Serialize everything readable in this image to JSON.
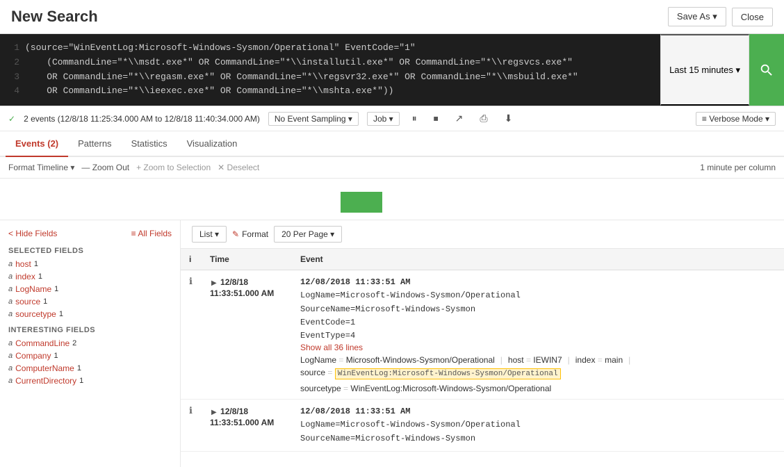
{
  "header": {
    "title": "New Search",
    "save_as_label": "Save As ▾",
    "close_label": "Close"
  },
  "query": {
    "lines": [
      {
        "num": "1",
        "text": "(source=\"WinEventLog:Microsoft-Windows-Sysmon/Operational\" EventCode=\"1\""
      },
      {
        "num": "2",
        "text": "    (CommandLine=\"*\\\\msdt.exe*\" OR CommandLine=\"*\\\\installutil.exe*\" OR CommandLine=\"*\\\\regsvcs.exe*\""
      },
      {
        "num": "3",
        "text": "    OR CommandLine=\"*\\\\regasm.exe*\" OR CommandLine=\"*\\\\regsvr32.exe*\" OR CommandLine=\"*\\\\msbuild.exe*\""
      },
      {
        "num": "4",
        "text": "    OR CommandLine=\"*\\\\ieexec.exe*\" OR CommandLine=\"*\\\\mshta.exe*\"))"
      }
    ]
  },
  "time_picker": {
    "label": "Last 15 minutes ▾"
  },
  "status_bar": {
    "check": "✓",
    "events_text": "2 events (12/8/18 11:25:34.000 AM to 12/8/18 11:40:34.000 AM)",
    "sampling_label": "No Event Sampling ▾",
    "job_label": "Job ▾",
    "pause_icon": "⏸",
    "stop_icon": "⏹",
    "send_icon": "↗",
    "print_icon": "⎙",
    "download_icon": "⬇",
    "verbose_label": "≡ Verbose Mode ▾"
  },
  "tabs": [
    {
      "label": "Events (2)",
      "active": true
    },
    {
      "label": "Patterns",
      "active": false
    },
    {
      "label": "Statistics",
      "active": false
    },
    {
      "label": "Visualization",
      "active": false
    }
  ],
  "timeline": {
    "format_timeline_label": "Format Timeline ▾",
    "zoom_out_label": "— Zoom Out",
    "zoom_selection_label": "+ Zoom to Selection",
    "deselect_label": "✕ Deselect",
    "per_column_label": "1 minute per column"
  },
  "sidebar": {
    "hide_fields_label": "< Hide Fields",
    "all_fields_label": "≡ All Fields",
    "selected_fields_title": "SELECTED FIELDS",
    "selected_fields": [
      {
        "type": "a",
        "name": "host",
        "count": "1"
      },
      {
        "type": "a",
        "name": "index",
        "count": "1"
      },
      {
        "type": "a",
        "name": "LogName",
        "count": "1"
      },
      {
        "type": "a",
        "name": "source",
        "count": "1"
      },
      {
        "type": "a",
        "name": "sourcetype",
        "count": "1"
      }
    ],
    "interesting_fields_title": "INTERESTING FIELDS",
    "interesting_fields": [
      {
        "type": "a",
        "name": "CommandLine",
        "count": "2"
      },
      {
        "type": "a",
        "name": "Company",
        "count": "1"
      },
      {
        "type": "a",
        "name": "ComputerName",
        "count": "1"
      },
      {
        "type": "a",
        "name": "CurrentDirectory",
        "count": "1"
      }
    ]
  },
  "view_controls": {
    "list_label": "List ▾",
    "format_icon": "✎",
    "format_label": "Format",
    "per_page_label": "20 Per Page ▾"
  },
  "table": {
    "col_info": "i",
    "col_time": "Time",
    "col_event": "Event"
  },
  "events": [
    {
      "time_short": "12/8/18",
      "time_full": "11:33:51.000 AM",
      "timestamp": "12/08/2018 11:33:51 AM",
      "body_lines": [
        "LogName=Microsoft-Windows-Sysmon/Operational",
        "SourceName=Microsoft-Windows-Sysmon",
        "EventCode=1",
        "EventType=4"
      ],
      "show_lines": "Show all 36 lines",
      "fields": [
        {
          "name": "LogName",
          "sep": "=",
          "val": "Microsoft-Windows-Sysmon/Operational"
        },
        {
          "name": "host",
          "sep": "=",
          "val": "IEWIN7"
        },
        {
          "name": "index",
          "sep": "=",
          "val": "main"
        }
      ],
      "fields2": [
        {
          "name": "source",
          "sep": "=",
          "val": "WinEventLog:Microsoft-Windows-Sysmon/Operational",
          "highlight": true
        },
        {
          "name": "sourcetype",
          "sep": "=",
          "val": "WinEventLog:Microsoft-Windows-Sysmon/Operational"
        }
      ]
    },
    {
      "time_short": "12/8/18",
      "time_full": "11:33:51.000 AM",
      "timestamp": "12/08/2018 11:33:51 AM",
      "body_lines": [
        "LogName=Microsoft-Windows-Sysmon/Operational",
        "SourceName=Microsoft-Windows-Sysmon"
      ],
      "show_lines": "",
      "fields": [],
      "fields2": []
    }
  ]
}
